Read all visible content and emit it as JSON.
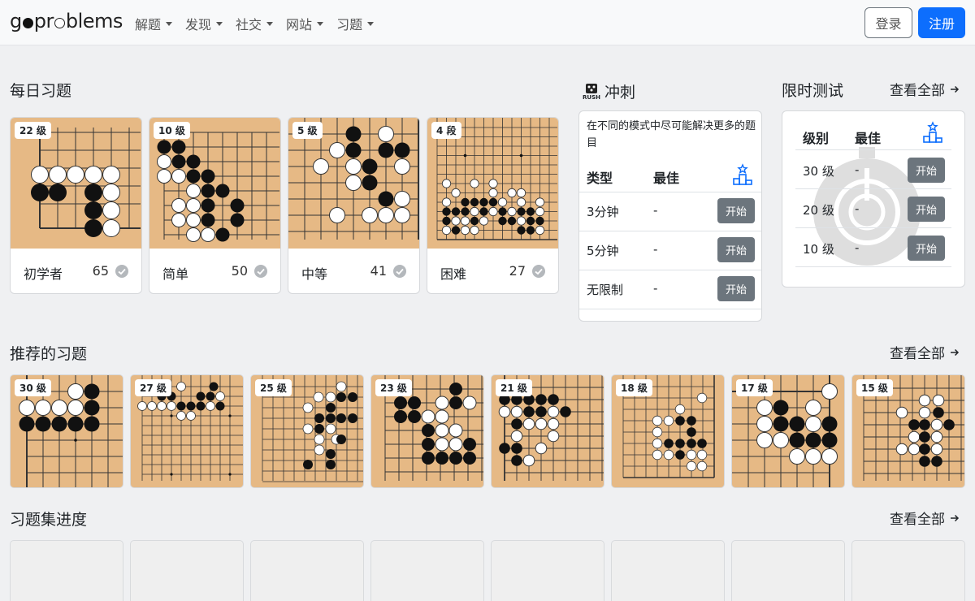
{
  "nav": {
    "logo": {
      "part1": "g",
      "part2": "pr",
      "part3": "blems"
    },
    "items": [
      "解题",
      "发现",
      "社交",
      "网站",
      "习题"
    ],
    "login": "登录",
    "register": "注册"
  },
  "daily": {
    "title": "每日习题",
    "cards": [
      {
        "badge": "22 级",
        "name": "初学者",
        "count": "65"
      },
      {
        "badge": "10 级",
        "name": "简单",
        "count": "50"
      },
      {
        "badge": "5 级",
        "name": "中等",
        "count": "41"
      },
      {
        "badge": "4 段",
        "name": "困难",
        "count": "27"
      }
    ]
  },
  "rush": {
    "title": "冲刺",
    "icon_label": "RUSH",
    "desc": "在不同的模式中尽可能解决更多的题目",
    "col_type": "类型",
    "col_best": "最佳",
    "rows": [
      {
        "type": "3分钟",
        "best": "-",
        "btn": "开始"
      },
      {
        "type": "5分钟",
        "best": "-",
        "btn": "开始"
      },
      {
        "type": "无限制",
        "best": "-",
        "btn": "开始"
      }
    ]
  },
  "timed": {
    "title": "限时测试",
    "view_all": "查看全部",
    "col_level": "级别",
    "col_best": "最佳",
    "rows": [
      {
        "level": "30 级",
        "best": "-",
        "btn": "开始"
      },
      {
        "level": "20 级",
        "best": "-",
        "btn": "开始"
      },
      {
        "level": "10 级",
        "best": "-",
        "btn": "开始"
      }
    ]
  },
  "recommended": {
    "title": "推荐的习题",
    "view_all": "查看全部",
    "badges": [
      "30 级",
      "27 级",
      "25 级",
      "23 级",
      "21 级",
      "18 级",
      "17 级",
      "15 级"
    ]
  },
  "sets": {
    "title": "习题集进度",
    "view_all": "查看全部"
  },
  "colors": {
    "board": "#e6b985",
    "accent": "#0d6efd",
    "start_button": "#6c757d"
  }
}
